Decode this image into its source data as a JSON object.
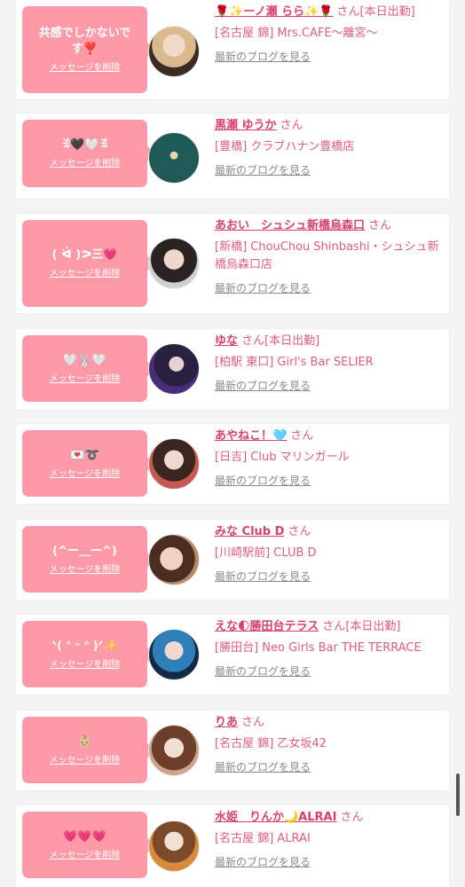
{
  "delete_label": "メッセージを削除",
  "blog_label": "最新のブログを見る",
  "san_label": "さん",
  "accent_color": "#fe9aa7",
  "text_color": "#e05c7d",
  "items": [
    {
      "message": "共感でしかないです❣️",
      "name": "🌹✨ーノ瀬 らら✨🌹",
      "status": "[本日出勤]",
      "shop": "[名古屋 錦] Mrs.CAFE〜離宮〜",
      "avatar_icon": "woman-blonde-avatar"
    },
    {
      "message": "ꉂ🖤🤍ꉂ",
      "name": "黒瀬 ゆうか",
      "status": "",
      "shop": "[豊橋] クラブハナン豊橋店",
      "avatar_icon": "club-hanan-logo-avatar"
    },
    {
      "message": "( ᐛ )ᕗ三💗",
      "name": "あおい　シュシュ新橋烏森口",
      "status": "",
      "shop": "[新橋] ChouChou Shinbashi・シュシュ新橋烏森口店",
      "avatar_icon": "woman-dark-hair-avatar"
    },
    {
      "message": "🤍🐰🤍",
      "name": "ゆな",
      "status": "[本日出勤]",
      "shop": "[柏駅 東口] Girl's Bar SELIER",
      "avatar_icon": "woman-bar-avatar"
    },
    {
      "message": "💌➰",
      "name": "あやねこ！🩵",
      "status": "",
      "shop": "[日吉] Club マリンガール",
      "avatar_icon": "woman-selfie-avatar"
    },
    {
      "message": "(^ー＿ー^)",
      "name": "みな Club D",
      "status": "",
      "shop": "[川崎駅前] CLUB D",
      "avatar_icon": "woman-closeup-avatar"
    },
    {
      "message": "ᐠ( ᐢ ᵕ ᐢ )ᐟ✨",
      "name": "えな🌓勝田台テラス",
      "status": "[本日出勤]",
      "shop": "[勝田台] Neo Girls Bar THE TERRACE",
      "avatar_icon": "woman-blue-hair-avatar"
    },
    {
      "message": "👶🏼",
      "name": "りあ",
      "status": "",
      "shop": "[名古屋 錦] 乙女坂42",
      "avatar_icon": "woman-bob-avatar"
    },
    {
      "message": "💗💗💗",
      "name": "水姫　りんか🌙ALRAI",
      "status": "",
      "shop": "[名古屋 錦] ALRAI",
      "avatar_icon": "woman-dress-avatar"
    }
  ]
}
